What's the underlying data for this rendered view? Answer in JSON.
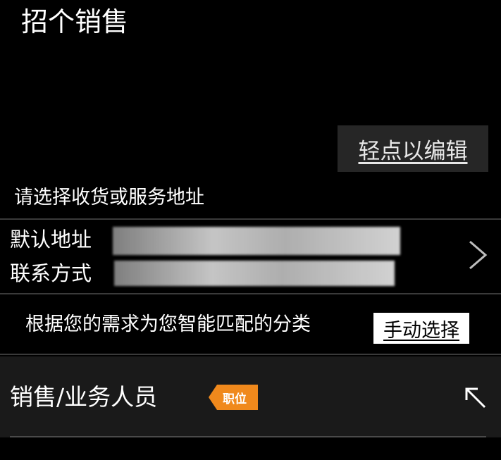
{
  "page": {
    "title": "招个销售"
  },
  "edit": {
    "label": "轻点以编辑"
  },
  "address_section": {
    "heading": "请选择收货或服务地址",
    "default_address_label": "默认地址",
    "contact_label": "联系方式"
  },
  "match": {
    "text": "根据您的需求为您智能匹配的分类",
    "manual_select_label": "手动选择"
  },
  "category": {
    "label": "销售/业务人员",
    "tag": "职位"
  },
  "icons": {
    "address_chevron": "chevron-right-icon",
    "category_toggle": "arrow-up-left-icon"
  },
  "colors": {
    "background": "#000000",
    "card": "#1a1a1a",
    "edit_button_bg": "#262626",
    "tag_accent": "#f0891c",
    "manual_button_bg": "#ffffff"
  }
}
